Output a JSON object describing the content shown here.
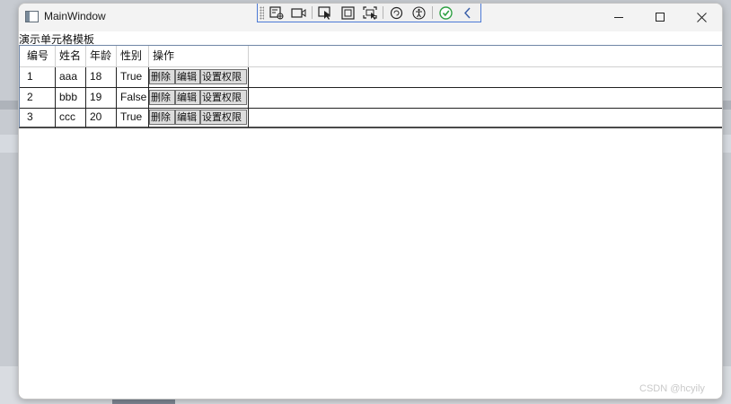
{
  "window": {
    "title": "MainWindow"
  },
  "caption": "演示单元格模板",
  "grid": {
    "headers": [
      "编号",
      "姓名",
      "年龄",
      "性别",
      "操作"
    ],
    "rows": [
      {
        "id": "1",
        "name": "aaa",
        "age": "18",
        "gender": "True"
      },
      {
        "id": "2",
        "name": "bbb",
        "age": "19",
        "gender": "False"
      },
      {
        "id": "3",
        "name": "ccc",
        "age": "20",
        "gender": "True"
      }
    ],
    "actions": {
      "delete": "删除",
      "edit": "编辑",
      "perm": "设置权限"
    }
  },
  "devbar": {
    "icons": [
      "live-visual-tree-icon",
      "select-element-icon",
      "display-adorners-icon",
      "track-focus-icon",
      "hot-reload-icon",
      "accessibility-icon",
      "binding-check-icon",
      "collapse-icon"
    ]
  },
  "watermark": "CSDN @hcyily",
  "colors": {
    "title_bg": "#f3f3f3",
    "devbar_border": "#4d7bd6",
    "grid_border": "#6f86a6"
  }
}
